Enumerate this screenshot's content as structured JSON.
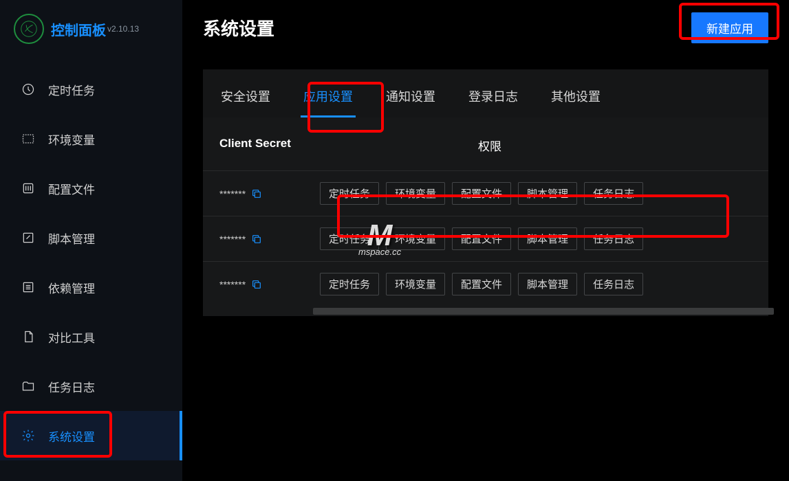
{
  "brand": {
    "title": "控制面板",
    "version": "v2.10.13"
  },
  "sidebar": {
    "items": [
      {
        "label": "定时任务"
      },
      {
        "label": "环境变量"
      },
      {
        "label": "配置文件"
      },
      {
        "label": "脚本管理"
      },
      {
        "label": "依赖管理"
      },
      {
        "label": "对比工具"
      },
      {
        "label": "任务日志"
      },
      {
        "label": "系统设置"
      }
    ]
  },
  "header": {
    "title": "系统设置",
    "new_button": "新建应用"
  },
  "tabs": [
    {
      "label": "安全设置"
    },
    {
      "label": "应用设置"
    },
    {
      "label": "通知设置"
    },
    {
      "label": "登录日志"
    },
    {
      "label": "其他设置"
    }
  ],
  "table": {
    "headers": {
      "secret": "Client Secret",
      "permissions": "权限"
    },
    "rows": [
      {
        "secret": "*******",
        "tags": [
          "定时任务",
          "环境变量",
          "配置文件",
          "脚本管理",
          "任务日志"
        ]
      },
      {
        "secret": "*******",
        "tags": [
          "定时任务",
          "环境变量",
          "配置文件",
          "脚本管理",
          "任务日志"
        ]
      },
      {
        "secret": "*******",
        "tags": [
          "定时任务",
          "环境变量",
          "配置文件",
          "脚本管理",
          "任务日志"
        ]
      }
    ]
  },
  "watermark": {
    "logo": "M",
    "text": "mspace.cc"
  }
}
